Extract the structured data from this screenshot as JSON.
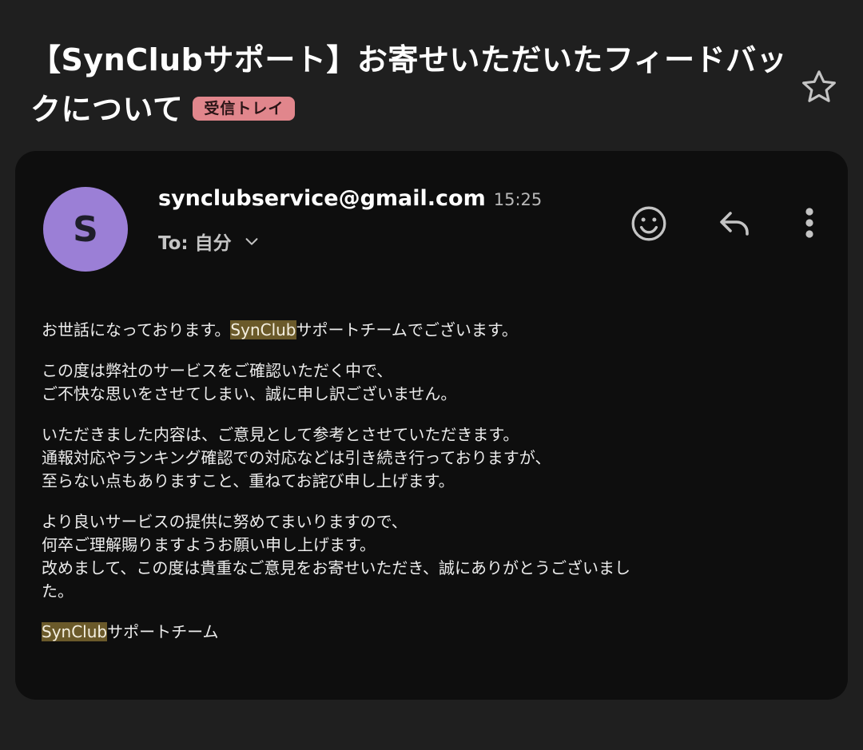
{
  "email": {
    "subject": "【SynClubサポート】お寄せいただいたフィードバックについて",
    "label": "受信トレイ",
    "avatar_letter": "S",
    "sender": "synclubservice@gmail.com",
    "time": "15:25",
    "to": "To: 自分",
    "body": {
      "p1": {
        "pre": "お世話になっております。",
        "hl": "SynClub",
        "post": "サポートチームでございます。"
      },
      "p2": [
        "この度は弊社のサービスをご確認いただく中で、",
        "ご不快な思いをさせてしまい、誠に申し訳ございません。"
      ],
      "p3": [
        "いただきました内容は、ご意見として参考とさせていただきます。",
        "通報対応やランキング確認での対応などは引き続き行っておりますが、",
        "至らない点もありますこと、重ねてお詫び申し上げます。"
      ],
      "p4": [
        "より良いサービスの提供に努めてまいりますので、",
        "何卒ご理解賜りますようお願い申し上げます。",
        "改めまして、この度は貴重なご意見をお寄せいただき、誠にありがとうございまし",
        "た。"
      ],
      "signature": {
        "hl": "SynClub",
        "post": "サポートチーム"
      }
    }
  },
  "icons": {
    "star": "star-icon",
    "emoji": "emoji-icon",
    "reply": "reply-icon",
    "more": "more-vert-icon",
    "chevron": "chevron-down-icon"
  },
  "colors": {
    "background": "#1f1f1f",
    "card": "#0e0e0e",
    "avatar": "#9b7fd6",
    "label_chip": "#e1868c",
    "highlight": "#6b5a2a"
  }
}
